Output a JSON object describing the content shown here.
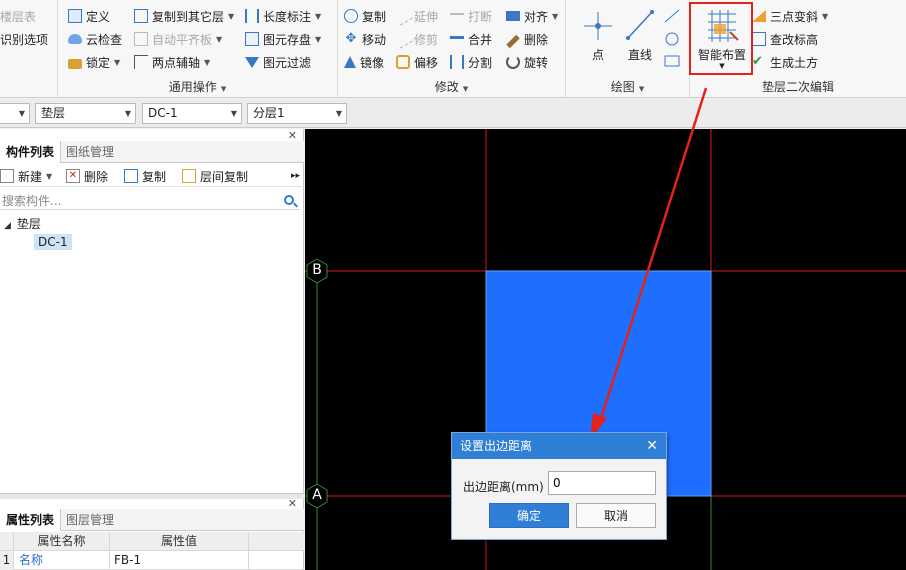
{
  "ribbon": {
    "group0": {
      "btn_floor_table": "楼层表",
      "btn_identify_options": "识别选项"
    },
    "common": {
      "title": "通用操作",
      "define": "定义",
      "cloud_check": "云检查",
      "lock": "锁定",
      "copy_to_other_floor": "复制到其它层",
      "auto_flat_slab": "自动平齐板",
      "two_point_aux": "两点辅轴",
      "length_dim": "长度标注",
      "element_save": "图元存盘",
      "element_filter": "图元过滤"
    },
    "modify": {
      "title": "修改",
      "copy": "复制",
      "move": "移动",
      "mirror": "镜像",
      "extend": "延伸",
      "trim": "修剪",
      "offset": "偏移",
      "break": "打断",
      "merge": "合并",
      "split": "分割",
      "align": "对齐",
      "delete": "删除",
      "rotate": "旋转"
    },
    "draw": {
      "title": "绘图",
      "point": "点",
      "line": "直线"
    },
    "cushion": {
      "title": "垫层二次编辑",
      "smart_layout": "智能布置",
      "three_point_slope": "三点变斜",
      "check_elevation": "查改标高",
      "generate_earthwork": "生成土方"
    }
  },
  "selectors": {
    "sel1": "",
    "sel2": "垫层",
    "sel3": "DC-1",
    "sel4": "分层1"
  },
  "component_panel": {
    "tab_list": "构件列表",
    "tab_drawings": "图纸管理",
    "new": "新建",
    "delete": "删除",
    "copy": "复制",
    "floor_copy": "层间复制",
    "search_placeholder": "搜索构件...",
    "tree_parent": "垫层",
    "tree_child": "DC-1"
  },
  "property_panel": {
    "tab_props": "属性列表",
    "tab_layers": "图层管理",
    "col_name": "属性名称",
    "col_value": "属性值",
    "rows": [
      {
        "index": "1",
        "name": "名称",
        "value": "FB-1"
      }
    ]
  },
  "canvas": {
    "axis_b": "B",
    "axis_a": "A"
  },
  "dialog": {
    "title": "设置出边距离",
    "label": "出边距离(mm)",
    "value": "0",
    "ok": "确定",
    "cancel": "取消"
  },
  "colors": {
    "accent_blue": "#2f7fd6",
    "pad_blue": "#1f6fff",
    "grid_red": "#d8181c",
    "highlight_red": "#e0241c"
  }
}
